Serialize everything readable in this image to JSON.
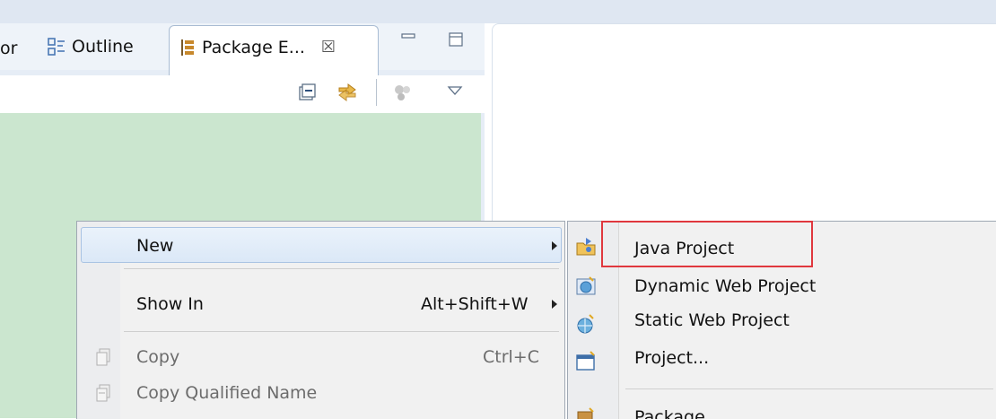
{
  "tabs": {
    "partial_label": "or",
    "outline_label": "Outline",
    "package_label": "Package E...",
    "close_glyph": "☒"
  },
  "context_menu": {
    "items": [
      {
        "label": "New",
        "shortcut": "",
        "has_submenu": true,
        "enabled": true
      },
      {
        "label": "Show In",
        "shortcut": "Alt+Shift+W",
        "has_submenu": true,
        "enabled": true
      },
      {
        "label": "Copy",
        "shortcut": "Ctrl+C",
        "has_submenu": false,
        "enabled": false
      },
      {
        "label": "Copy Qualified Name",
        "shortcut": "",
        "has_submenu": false,
        "enabled": false
      }
    ]
  },
  "submenu": {
    "items": [
      {
        "label": "Java Project",
        "icon": "java-project-icon"
      },
      {
        "label": "Dynamic Web Project",
        "icon": "dynamic-web-project-icon"
      },
      {
        "label": "Static Web Project",
        "icon": "static-web-project-icon"
      },
      {
        "label": "Project...",
        "icon": "project-icon"
      },
      {
        "label": "Package",
        "icon": "package-icon"
      }
    ]
  },
  "colors": {
    "package_explorer_bg": "#cbe6cf",
    "highlight_box": "#e0383e",
    "menu_bg": "#f1f1f1"
  }
}
